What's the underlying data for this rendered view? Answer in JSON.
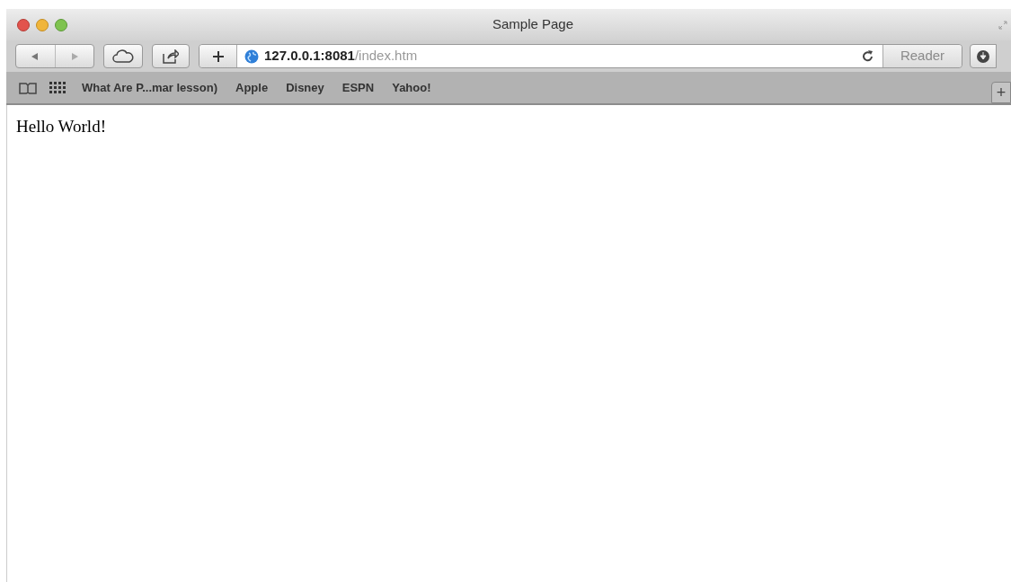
{
  "window": {
    "title": "Sample Page"
  },
  "toolbar": {
    "url_host": "127.0.0.1:8081",
    "url_path": "/index.htm",
    "reader": {
      "label": "Reader",
      "disabled": true
    },
    "new_tab_label": "+"
  },
  "bookmarks": [
    {
      "label": "What Are P...mar lesson)"
    },
    {
      "label": "Apple"
    },
    {
      "label": "Disney"
    },
    {
      "label": "ESPN"
    },
    {
      "label": "Yahoo!"
    }
  ],
  "page": {
    "text": "Hello World!"
  }
}
